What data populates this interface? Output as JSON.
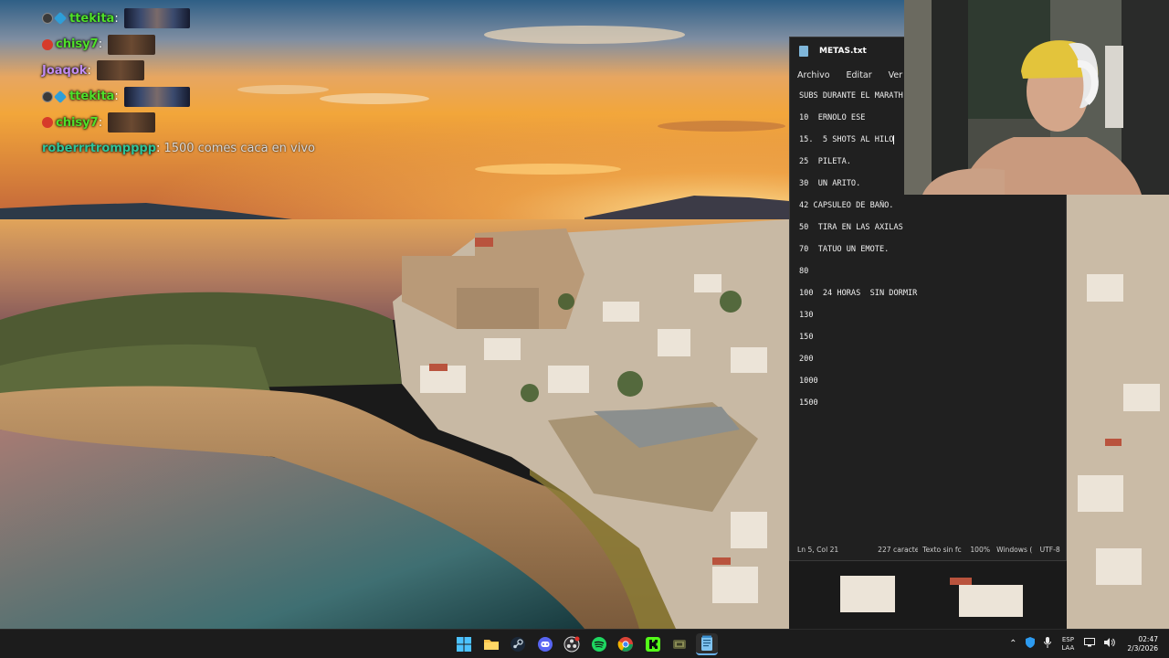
{
  "chat": {
    "messages": [
      {
        "user": "ttekita",
        "color": "#4fe02a",
        "badges": [
          "mod",
          "prime"
        ],
        "emote": "wide"
      },
      {
        "user": "chisy7",
        "color": "#4fe02a",
        "badges": [
          "sub"
        ],
        "emote": "mid"
      },
      {
        "user": "Joaqok",
        "color": "#c08cf0",
        "badges": [],
        "emote": "mid"
      },
      {
        "user": "ttekita",
        "color": "#4fe02a",
        "badges": [
          "mod",
          "prime"
        ],
        "emote": "wide"
      },
      {
        "user": "chisy7",
        "color": "#4fe02a",
        "badges": [
          "sub"
        ],
        "emote": "mid"
      },
      {
        "user": "roberrrtrompppp",
        "color": "#2ec39a",
        "badges": [],
        "text": "1500 comes caca en vivo"
      }
    ]
  },
  "notepad": {
    "title": "METAS.txt",
    "menu": [
      "Archivo",
      "Editar",
      "Ver"
    ],
    "lines": [
      "SUBS DURANTE EL MARATH",
      "10  ERNOLO ESE",
      "15.  5 SHOTS AL HILO",
      "25  PILETA.",
      "30  UN ARITO.",
      "42 CAPSULEO DE BAÑO.",
      "50  TIRA EN LAS AXILAS",
      "70  TATUO UN EMOTE.",
      "80",
      "100  24 HORAS  SIN DORMIR",
      "130",
      "150",
      "200",
      "1000",
      "1500"
    ],
    "status": {
      "position": "Ln 5, Col 21",
      "chars": "227 caracter",
      "format": "Texto sin fc",
      "zoom": "100%",
      "eol": "Windows (",
      "encoding": "UTF-8"
    }
  },
  "taskbar": {
    "apps": [
      "windows-start",
      "file-explorer",
      "steam",
      "discord",
      "obs-studio",
      "spotify",
      "chrome",
      "kick",
      "game-launcher",
      "notepad"
    ],
    "active_app": "notepad",
    "language": {
      "line1": "ESP",
      "line2": "LAA"
    },
    "time": "02:47",
    "date": "2/3/2026"
  }
}
